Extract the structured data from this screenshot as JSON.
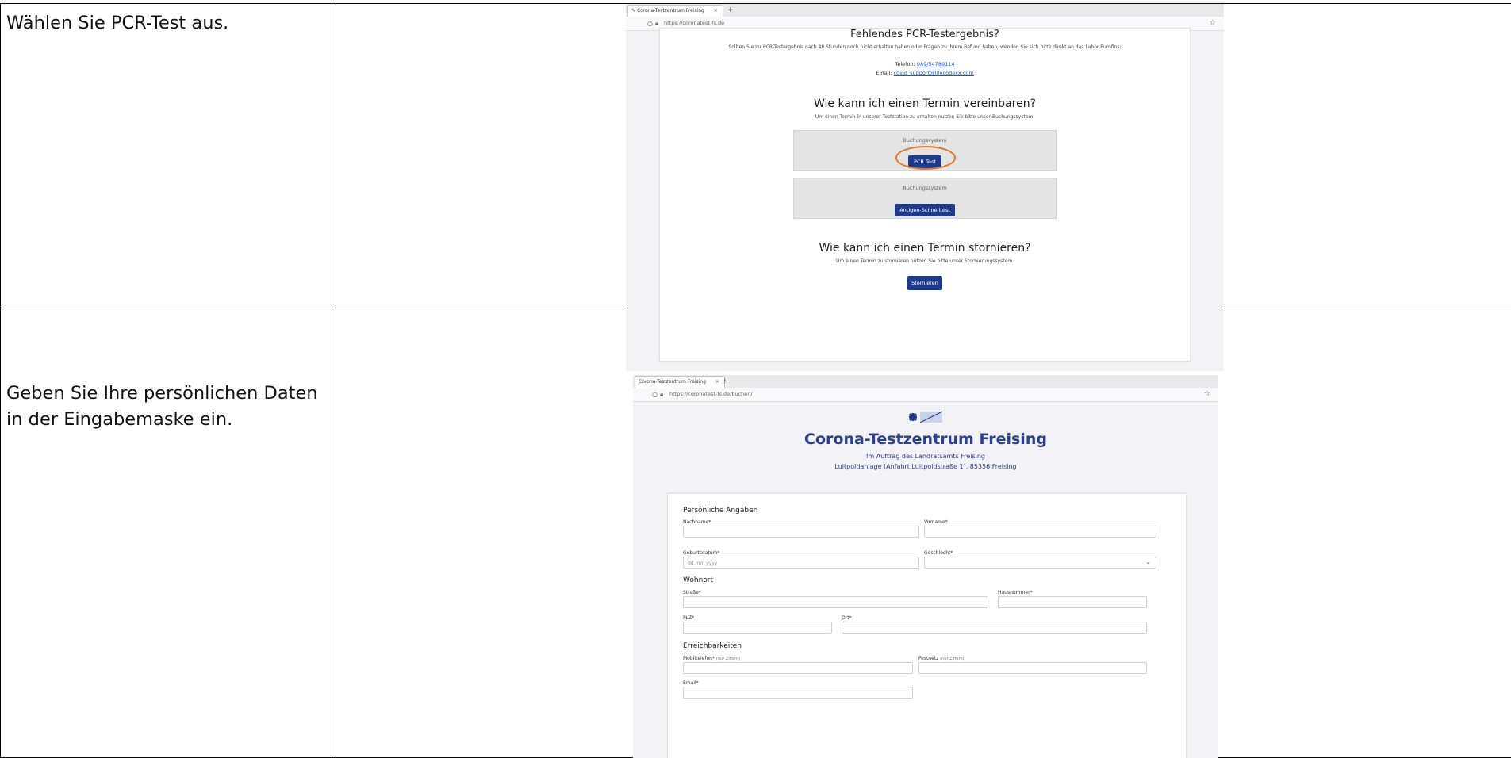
{
  "steps": [
    {
      "instruction": "Wählen Sie PCR-Test aus."
    },
    {
      "instruction": "Geben Sie Ihre persönlichen Daten in der Eingabemaske ein."
    }
  ],
  "shot1": {
    "tab_title": "Corona-Testzentrum Freising",
    "tab_close": "×",
    "new_tab": "+",
    "url": "https://coronatest-fs.de",
    "missing_heading": "Fehlendes PCR-Testergebnis?",
    "missing_text": "Sollten Sie Ihr PCR-Testergebnis nach 48 Stunden noch nicht erhalten haben oder Fragen zu Ihrem Befund haben, wenden Sie sich bitte direkt an das Labor Eurofins:",
    "phone_label": "Telefon:",
    "phone": "089/54789114",
    "email_label": "Email:",
    "email": "covid_support@lifecodexx.com",
    "book_heading": "Wie kann ich einen Termin vereinbaren?",
    "book_text": "Um einen Termin in unserer Teststation zu erhalten nutzen Sie bitte unser Buchungssystem.",
    "system_label_1": "Buchungssystem",
    "pcr_button": "PCR Test",
    "system_label_2": "Buchungssystem",
    "antigen_button": "Antigen-Schnelltest",
    "cancel_heading": "Wie kann ich einen Termin stornieren?",
    "cancel_text": "Um einen Termin zu stornieren nutzen Sie bitte unser Stornierungssystem.",
    "cancel_button": "Stornieren",
    "highlight_color": "#e07a2e",
    "accent": "#1e3a8a"
  },
  "shot2": {
    "tab_title": "Corona-Testzentrum Freising",
    "tab_close": "×",
    "new_tab": "+",
    "url": "https://coronatest-fs.de/buchen/",
    "site_title": "Corona-Testzentrum Freising",
    "subtitle_1": "Im Auftrag des Landratsamts Freising",
    "subtitle_2": "Luitpoldanlage (Anfahrt Luitpoldstraße 1), 85356 Freising",
    "personal_heading": "Persönliche Angaben",
    "lastname_label": "Nachname*",
    "firstname_label": "Vorname*",
    "birthdate_label": "Geburtsdatum*",
    "birthdate_placeholder": "dd.mm.yyyy",
    "gender_label": "Geschlecht*",
    "residence_heading": "Wohnort",
    "street_label": "Straße*",
    "housenumber_label": "Hausnummer*",
    "zip_label": "PLZ*",
    "city_label": "Ort*",
    "contact_heading": "Erreichbarkeiten",
    "mobile_label": "Mobiltelefon*",
    "mobile_hint": "(nur Ziffern)",
    "landline_label": "Festnetz",
    "landline_hint": "(nur Ziffern)",
    "email_label": "Email*",
    "title_color": "#2b3f8f"
  }
}
